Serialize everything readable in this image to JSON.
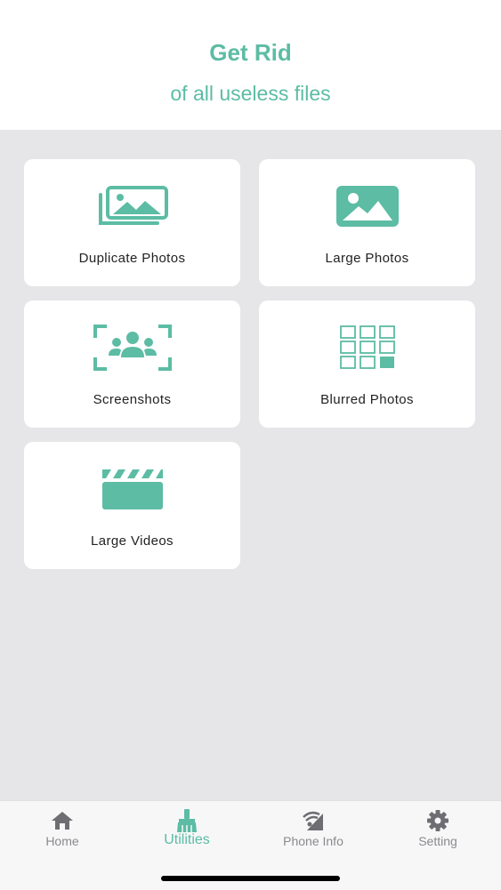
{
  "header": {
    "title": "Get Rid",
    "subtitle": "of all useless files"
  },
  "accent_color": "#5cbca4",
  "cards": [
    {
      "label": "Duplicate Photos",
      "icon": "duplicate-photos-icon"
    },
    {
      "label": "Large Photos",
      "icon": "image-icon"
    },
    {
      "label": "Screenshots",
      "icon": "screenshot-faces-icon"
    },
    {
      "label": "Blurred Photos",
      "icon": "grid-icon"
    },
    {
      "label": "Large Videos",
      "icon": "clapperboard-icon"
    }
  ],
  "tabs": [
    {
      "label": "Home",
      "icon": "home-icon",
      "active": false
    },
    {
      "label": "Utilities",
      "icon": "broom-icon",
      "active": true
    },
    {
      "label": "Phone Info",
      "icon": "signal-icon",
      "active": false
    },
    {
      "label": "Setting",
      "icon": "gear-icon",
      "active": false
    }
  ]
}
